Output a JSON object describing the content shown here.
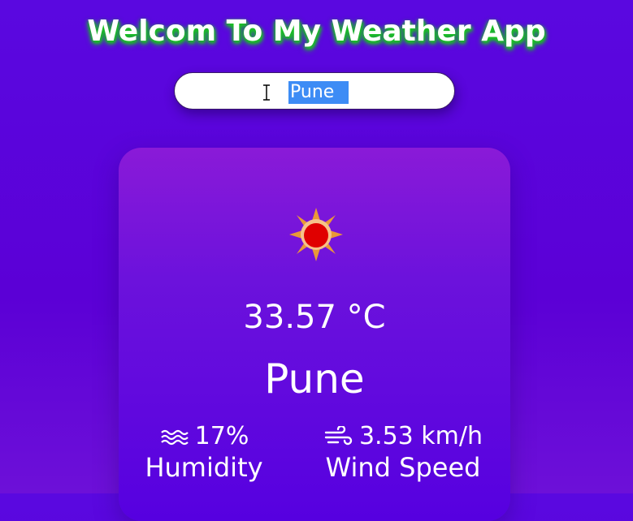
{
  "header": {
    "title": "Welcom To My Weather App"
  },
  "search": {
    "value": "Pune"
  },
  "weather": {
    "icon": "sun-icon",
    "temperature": "33.57 °C",
    "city": "Pune",
    "humidity": {
      "value": "17%",
      "label": "Humidity",
      "icon": "humidity-waves-icon"
    },
    "wind": {
      "value": "3.53 km/h",
      "label": "Wind Speed",
      "icon": "wind-icon"
    }
  },
  "colors": {
    "background": "#5b00d6",
    "title_glow": "#18c31e",
    "selection": "#3d8cf5",
    "sun_core": "#e00000",
    "sun_rays": "#f0a030"
  }
}
